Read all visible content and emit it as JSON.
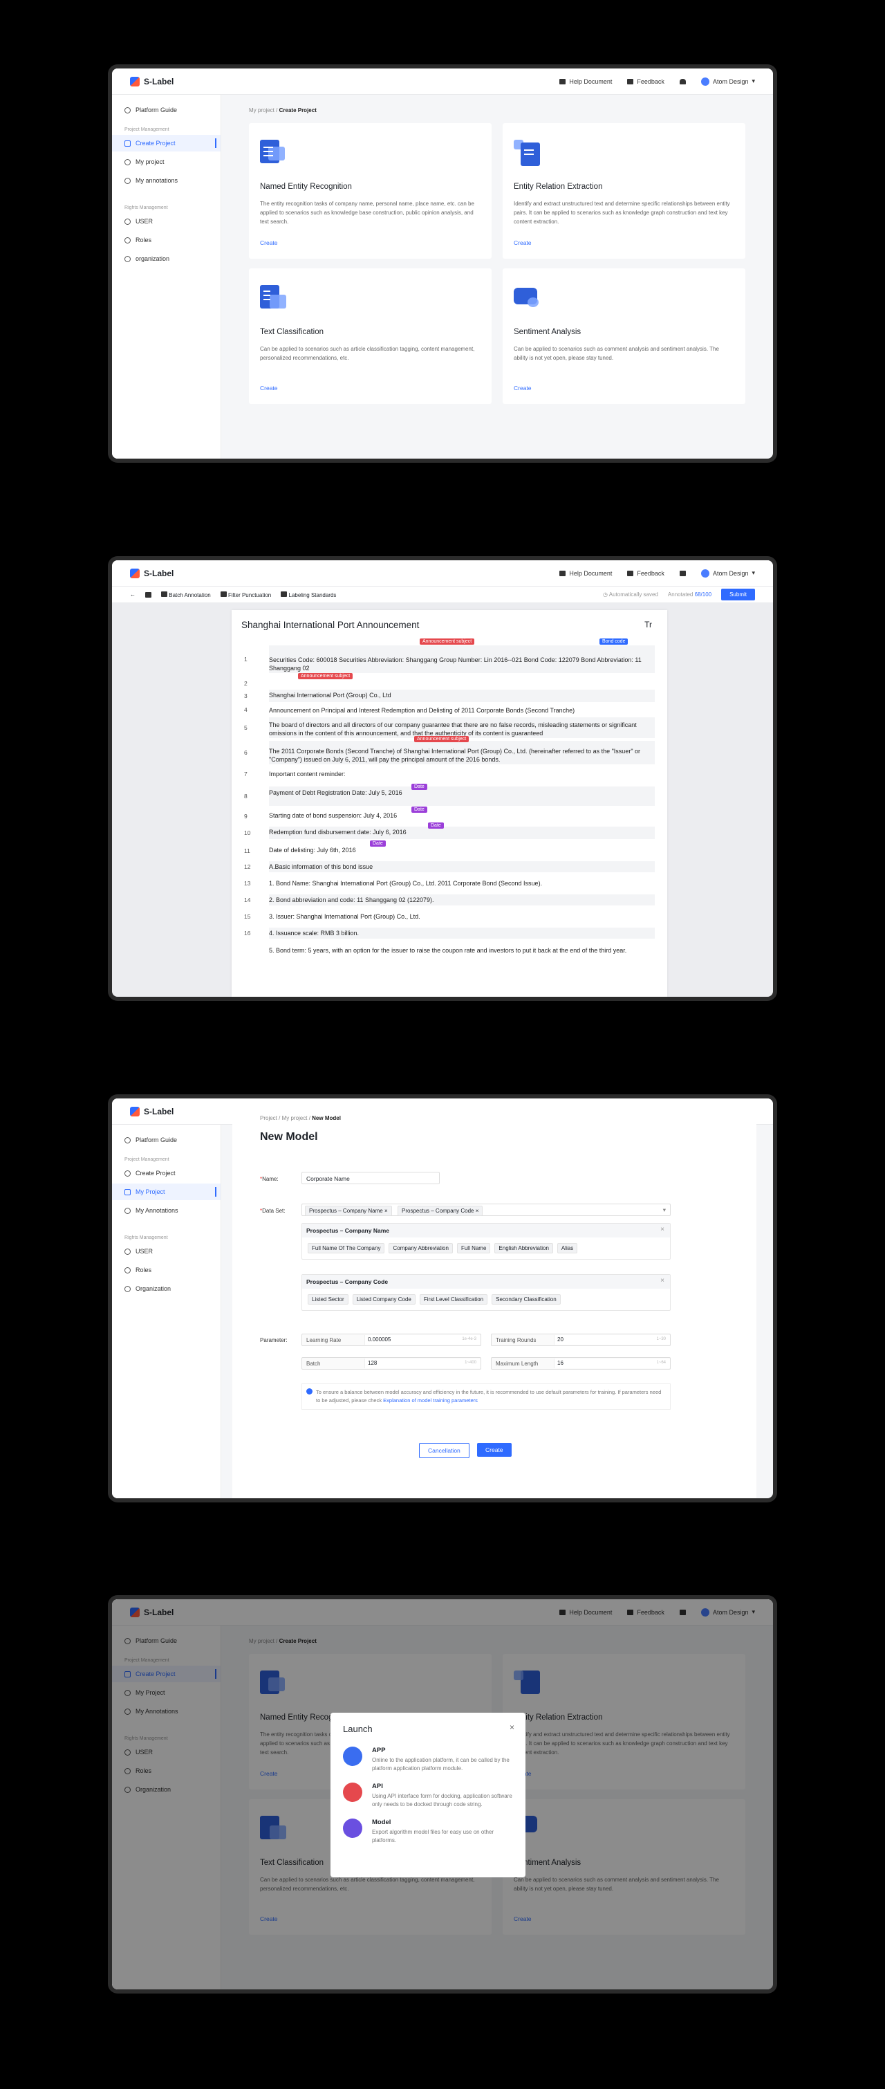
{
  "brand": "S-Label",
  "header": {
    "help": "Help Document",
    "feedback": "Feedback",
    "user": "Atom Design"
  },
  "sidebar1": {
    "guide": "Platform Guide",
    "group1": "Project Management",
    "items1": [
      "Create Project",
      "My project",
      "My annotations"
    ],
    "group2": "Rights Management",
    "items2": [
      "USER",
      "Roles",
      "organization"
    ]
  },
  "sidebar3": {
    "guide": "Platform Guide",
    "group1": "Project Management",
    "items1": [
      "Create Project",
      "My Project",
      "My Annotations"
    ],
    "group2": "Rights Management",
    "items2": [
      "USER",
      "Roles",
      "Organization"
    ]
  },
  "sidebar4": {
    "items1": [
      "Create Project",
      "My Project",
      "My Annotations"
    ],
    "items2": [
      "USER",
      "Roles",
      "Organization"
    ]
  },
  "crumb1": {
    "parent": "My project",
    "sep": "/",
    "current": "Create Project"
  },
  "cards": [
    {
      "title": "Named Entity Recognition",
      "desc": "The entity recognition tasks of company name, personal name, place name, etc. can be applied to scenarios such as knowledge base construction, public opinion analysis, and text search.",
      "link": "Create"
    },
    {
      "title": "Entity Relation Extraction",
      "desc": "Identify and extract unstructured text and determine specific relationships between entity pairs. It can be applied to scenarios such as knowledge graph construction and text key content extraction.",
      "link": "Create"
    },
    {
      "title": "Text Classification",
      "desc": "Can be applied to scenarios such as article classification tagging, content management, personalized recommendations, etc.",
      "link": "Create"
    },
    {
      "title": "Sentiment Analysis",
      "desc": "Can be applied to scenarios such as comment analysis and sentiment analysis. The ability is not yet open, please stay tuned.",
      "link": "Create"
    }
  ],
  "annot": {
    "tools": [
      "Batch Annotation",
      "Filter Punctuation",
      "Labeling Standards"
    ],
    "saved": "Automatically saved",
    "annotated_label": "Annotated",
    "annotated_value": "68/100",
    "submit": "Submit",
    "doc_title": "Shanghai International Port Announcement",
    "tr": "Tr",
    "lines": [
      {
        "n": "1",
        "t": "Securities Code: 600018 Securities Abbreviation: Shanggang Group Number: Lin 2016--021 Bond Code: 122079 Bond Abbreviation: 11 Shanggang 02"
      },
      {
        "n": "2",
        "t": ""
      },
      {
        "n": "3",
        "t": "Shanghai International Port (Group) Co., Ltd"
      },
      {
        "n": "4",
        "t": "Announcement on Principal and Interest Redemption and Delisting of 2011 Corporate Bonds (Second Tranche)"
      },
      {
        "n": "5",
        "t": "The board of directors and all directors of our company guarantee that there are no false records, misleading statements or significant omissions in the content of this announcement, and that the authenticity of its content is guaranteed"
      },
      {
        "n": "6",
        "t": "The 2011 Corporate Bonds (Second Tranche) of Shanghai International Port (Group) Co., Ltd. (hereinafter referred to as the \"Issuer\" or \"Company\") issued on July 6, 2011, will pay the principal amount of the 2016 bonds."
      },
      {
        "n": "7",
        "t": "Important content reminder:"
      },
      {
        "n": "8",
        "t": "Payment of Debt Registration Date: July 5, 2016"
      },
      {
        "n": "9",
        "t": "Starting date of bond suspension: July 4, 2016"
      },
      {
        "n": "10",
        "t": "Redemption fund disbursement date: July 6, 2016"
      },
      {
        "n": "11",
        "t": "Date of delisting: July 6th, 2016"
      },
      {
        "n": "12",
        "t": "A.Basic information of this bond issue"
      },
      {
        "n": "13",
        "t": "1. Bond Name: Shanghai International Port (Group) Co., Ltd. 2011 Corporate Bond (Second Issue)."
      },
      {
        "n": "14",
        "t": "2. Bond abbreviation and code: 11 Shanggang 02 (122079)."
      },
      {
        "n": "15",
        "t": "3. Issuer: Shanghai International Port (Group) Co., Ltd."
      },
      {
        "n": "16",
        "t": "4. Issuance scale: RMB 3 billion."
      },
      {
        "n": "",
        "t": "5. Bond term: 5 years, with an option for the issuer to raise the coupon rate and investors to put it back at the end of the third year."
      }
    ],
    "tags": {
      "subject": "Announcement subject",
      "bond": "Bond code",
      "date": "Date"
    },
    "colors": {
      "subject": "#e5484d",
      "bond": "#2f6bff",
      "date": "#9b3fd9"
    }
  },
  "model": {
    "crumb": [
      "Project",
      "My project",
      "New Model"
    ],
    "title": "New Model",
    "name_label": "Name:",
    "name_value": "Corporate Name",
    "dataset_label": "Data Set:",
    "dataset_values": [
      "Prospectus – Company Name",
      "Prospectus – Company Code"
    ],
    "sub1": {
      "title": "Prospectus – Company Name",
      "chips": [
        "Full Name Of The Company",
        "Company Abbreviation",
        "Full Name",
        "English Abbreviation",
        "Alias"
      ]
    },
    "sub2": {
      "title": "Prospectus – Company Code",
      "chips": [
        "Listed Sector",
        "Listed Company Code",
        "First Level Classification",
        "Secondary Classification"
      ]
    },
    "param_label": "Parameter:",
    "params": [
      {
        "l": "Learning Rate",
        "v": "0.000005",
        "h": "1e-4e-3"
      },
      {
        "l": "Training Rounds",
        "v": "20",
        "h": "1~30"
      },
      {
        "l": "Batch",
        "v": "128",
        "h": "1~400"
      },
      {
        "l": "Maximum Length",
        "v": "16",
        "h": "1~64"
      }
    ],
    "note": "To ensure a balance between model accuracy and efficiency in the future, it is recommended to use default parameters for training. If parameters need to be adjusted, please check",
    "note_link": "Explanation of model training parameters",
    "cancel": "Cancellation",
    "create": "Create"
  },
  "modal": {
    "title": "Launch",
    "options": [
      {
        "t": "APP",
        "d": "Online to the application platform, it can be called by the platform application platform module."
      },
      {
        "t": "API",
        "d": "Using API interface form for docking, application software only needs to be docked through code string."
      },
      {
        "t": "Model",
        "d": "Export algorithm model files for easy use on other platforms."
      }
    ],
    "colors": [
      "#3a6df0",
      "#e5484d",
      "#6a4fe0"
    ]
  }
}
